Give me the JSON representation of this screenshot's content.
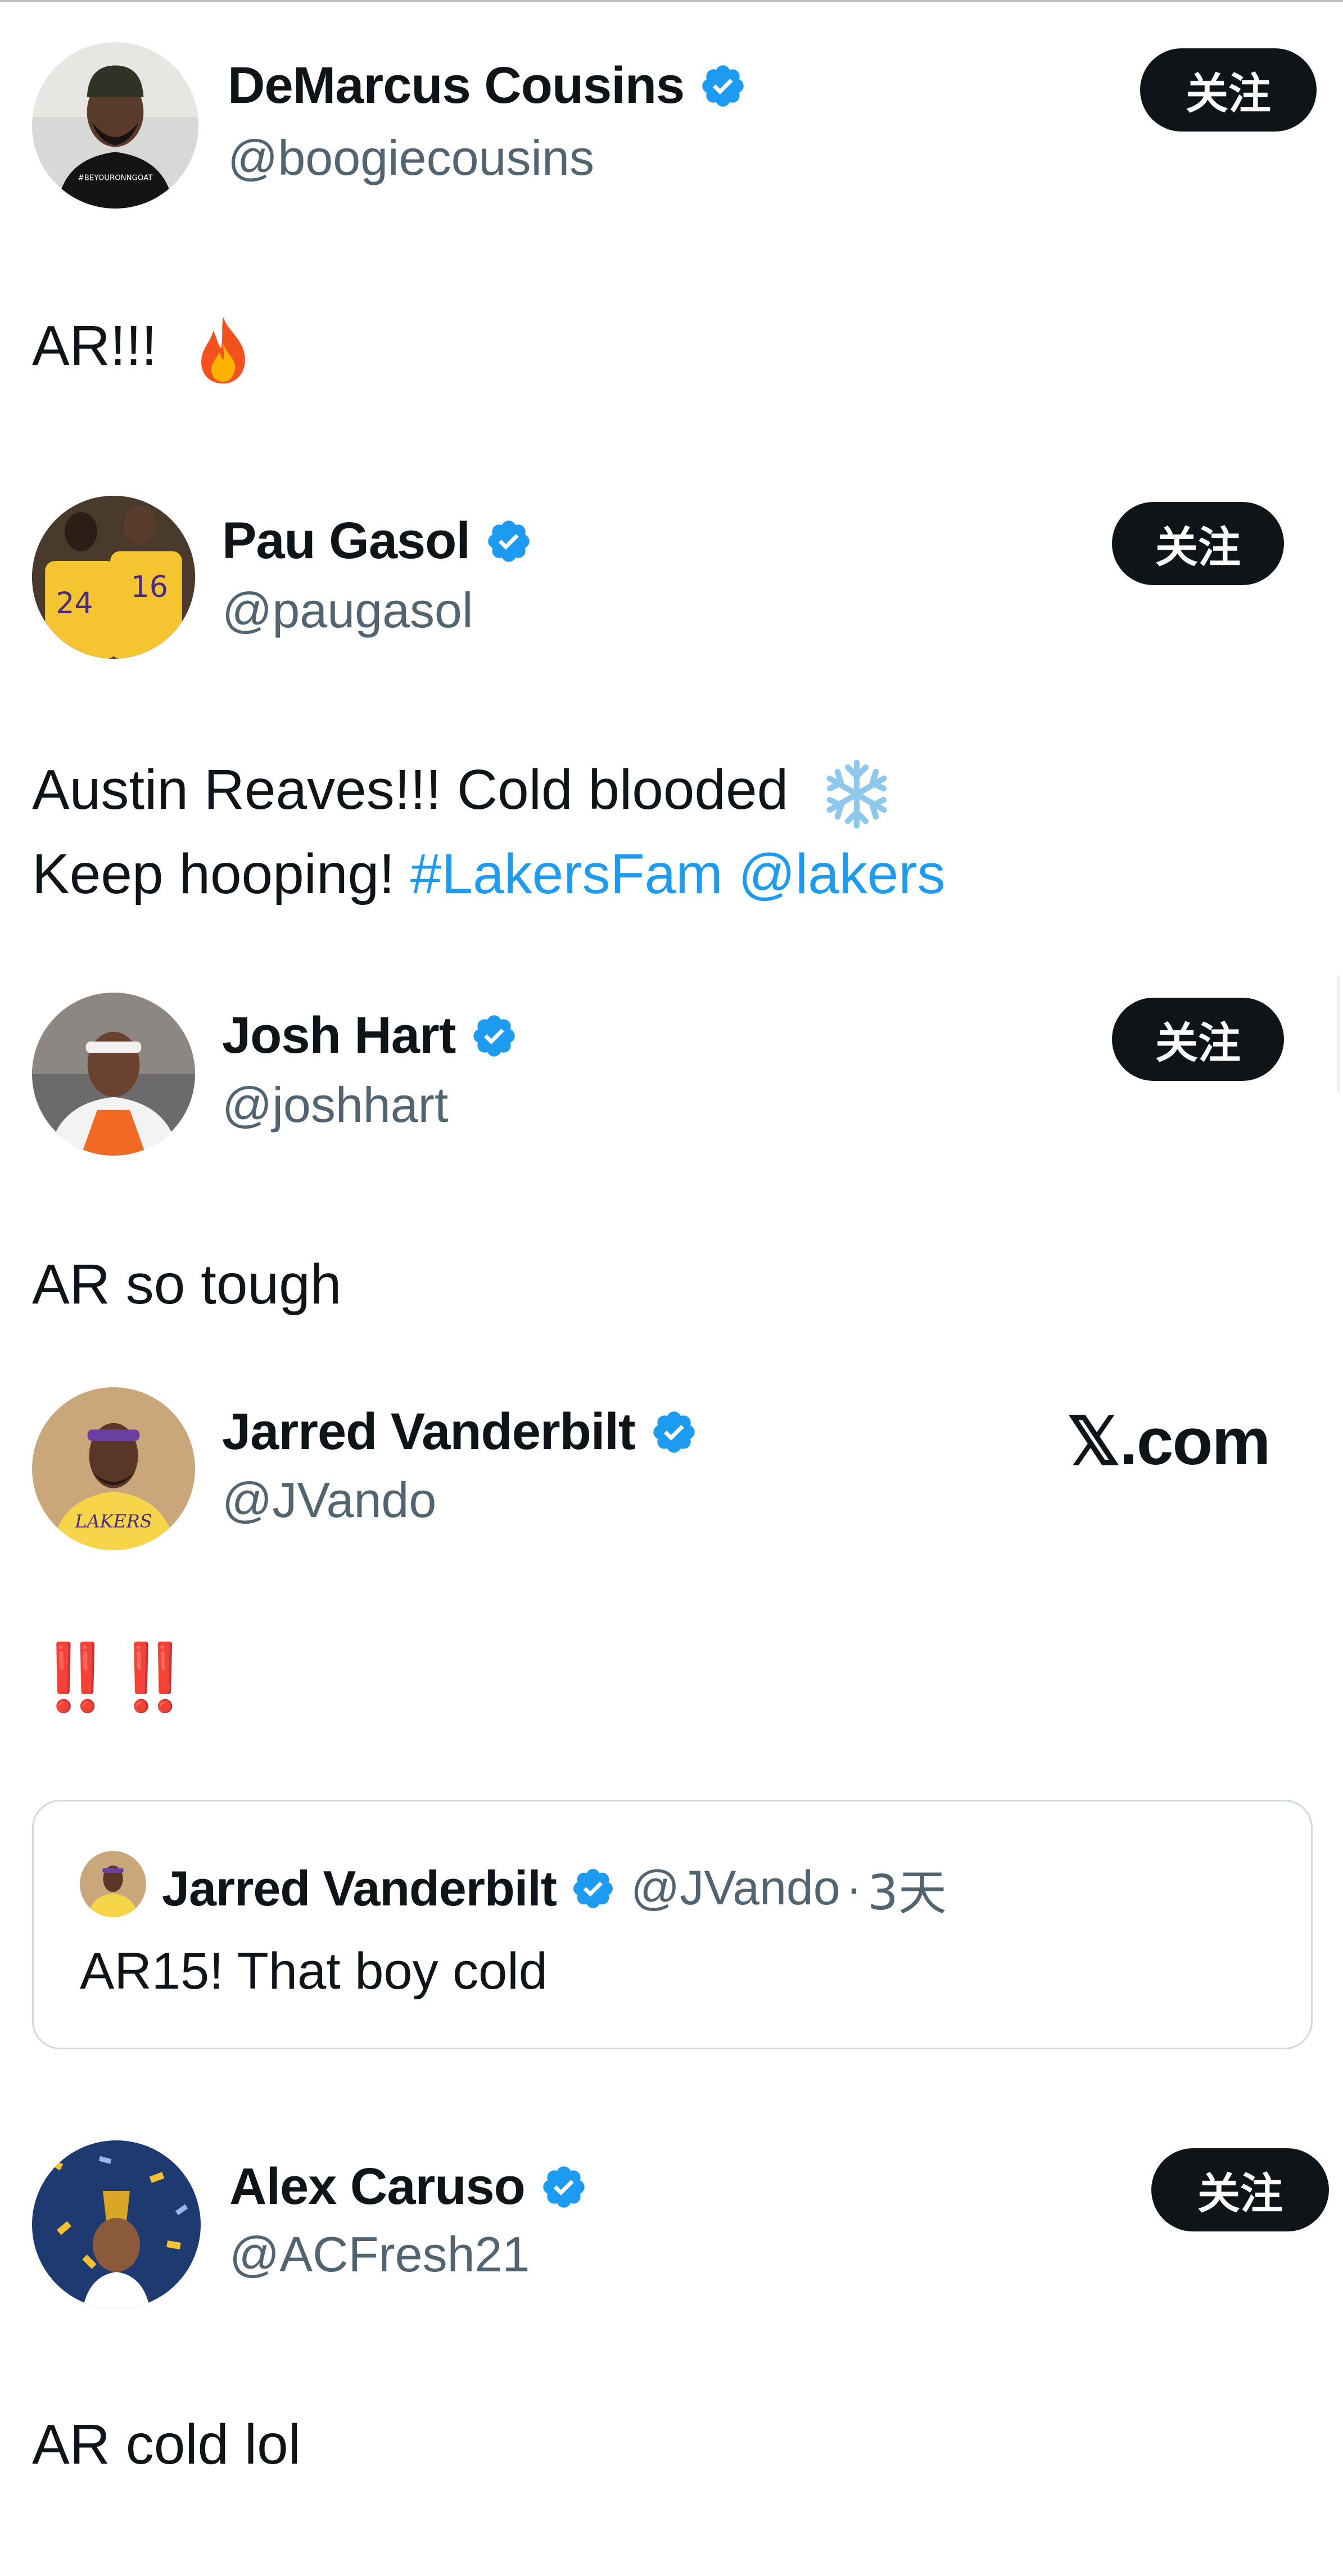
{
  "posts": [
    {
      "display_name": "DeMarcus Cousins",
      "handle": "@boogiecousins",
      "follow_label": "关注",
      "text": "AR!!!",
      "emoji": "fire-emoji"
    },
    {
      "display_name": "Pau Gasol",
      "handle": "@paugasol",
      "follow_label": "关注",
      "text_line1": "Austin Reaves!!! Cold blooded",
      "emoji": "snowflake-emoji",
      "text_line2_prefix": "Keep hooping!",
      "hashtag": "#LakersFam",
      "mention": "@lakers"
    },
    {
      "display_name": "Josh Hart",
      "handle": "@joshhart",
      "follow_label": "关注",
      "text": "AR so tough"
    },
    {
      "display_name": "Jarred Vanderbilt",
      "handle": "@JVando",
      "watermark": "𝕏.com",
      "text": "‼️‼️",
      "quote": {
        "display_name": "Jarred Vanderbilt",
        "handle": "@JVando",
        "separator": "·",
        "time": "3天",
        "text": "AR15! That boy cold"
      }
    },
    {
      "display_name": "Alex Caruso",
      "handle": "@ACFresh21",
      "follow_label": "关注",
      "text": "AR cold lol"
    }
  ],
  "colors": {
    "text": "#0f1419",
    "secondary": "#536471",
    "link": "#1d9bf0",
    "verified": "#1d9bf0",
    "button_bg": "#0f1419",
    "button_text": "#ffffff",
    "alert_red": "#e0201a"
  },
  "icons": {
    "verified": "verified-badge-icon",
    "fire": "fire-emoji",
    "snowflake": "snowflake-emoji"
  }
}
